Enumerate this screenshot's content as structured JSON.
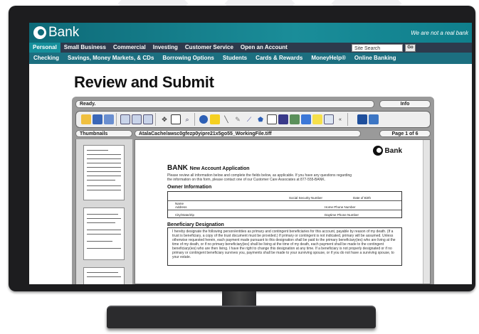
{
  "brand": {
    "name": "Bank",
    "tagline": "We are not a real bank"
  },
  "nav_primary": [
    "Personal",
    "Small Business",
    "Commercial",
    "Investing",
    "Customer Service",
    "Open an Account"
  ],
  "search": {
    "placeholder": "Site Search",
    "button": "Go"
  },
  "nav_secondary": [
    "Checking",
    "Savings, Money Markets, & CDs",
    "Borrowing Options",
    "Students",
    "Cards & Rewards",
    "MoneyHelp®",
    "Online Banking"
  ],
  "page_title": "Review and Submit",
  "viewer": {
    "status": "Ready.",
    "info_label": "Info",
    "thumbnails_label": "Thumbnails",
    "file_path": "AtalaCache/awsc0gfezp0yipre21x5go55_WorkingFile.tiff",
    "page_indicator": "Page 1 of 6",
    "toolbar_icons": [
      "open-folder-icon",
      "save-icon",
      "forward-icon",
      "page-icon",
      "page-icon",
      "page-icon",
      "pan-icon",
      "select-rect-icon",
      "zoom-icon",
      "ellipse-icon",
      "highlight-icon",
      "line-icon",
      "pen-icon",
      "brush-icon",
      "polygon-icon",
      "rectangle-icon",
      "filled-rect-icon",
      "image-icon",
      "stamp-icon",
      "note-icon",
      "text-icon",
      "collapse-icon",
      "prev-icon",
      "next-icon"
    ]
  },
  "document": {
    "bank_word": "BANK",
    "title": "New Account Application",
    "brand_name": "Bank",
    "intro": "Please review all information below and complete the fields below, as applicable. If you have any questions regarding the information on this form, please contact one of our Customer Care Associates at 877-555-BANK.",
    "owner_section": "Owner Information",
    "owner_fields": [
      "Name",
      "Social Security Number",
      "Date of Birth",
      "Address",
      "Home Phone Number",
      "City/State/Zip",
      "Daytime Phone Number"
    ],
    "beneficiary_section": "Beneficiary Designation",
    "beneficiary_text": "I hereby designate the following person/entities as primary and contingent beneficiaries for this account, payable by reason of my death. (If a trust is beneficiary, a copy of the trust document must be provided.) If primary or contingent is not indicated, primary will be assumed. Unless otherwise requested herein, each payment made pursuant to this designation shall be paid to the primary beneficiary(ies) who are living at the time of my death, or if no primary beneficiary(ies) shall be living at the time of my death, each payment shall be made to the contingent beneficiary(ies) who are then living. I have the right to change this designation at any time. If a beneficiary is not properly designated or if no primary or contingent beneficiary survives you, payments shall be made to your surviving spouse, or if you do not have a surviving spouse, to your estate."
  }
}
